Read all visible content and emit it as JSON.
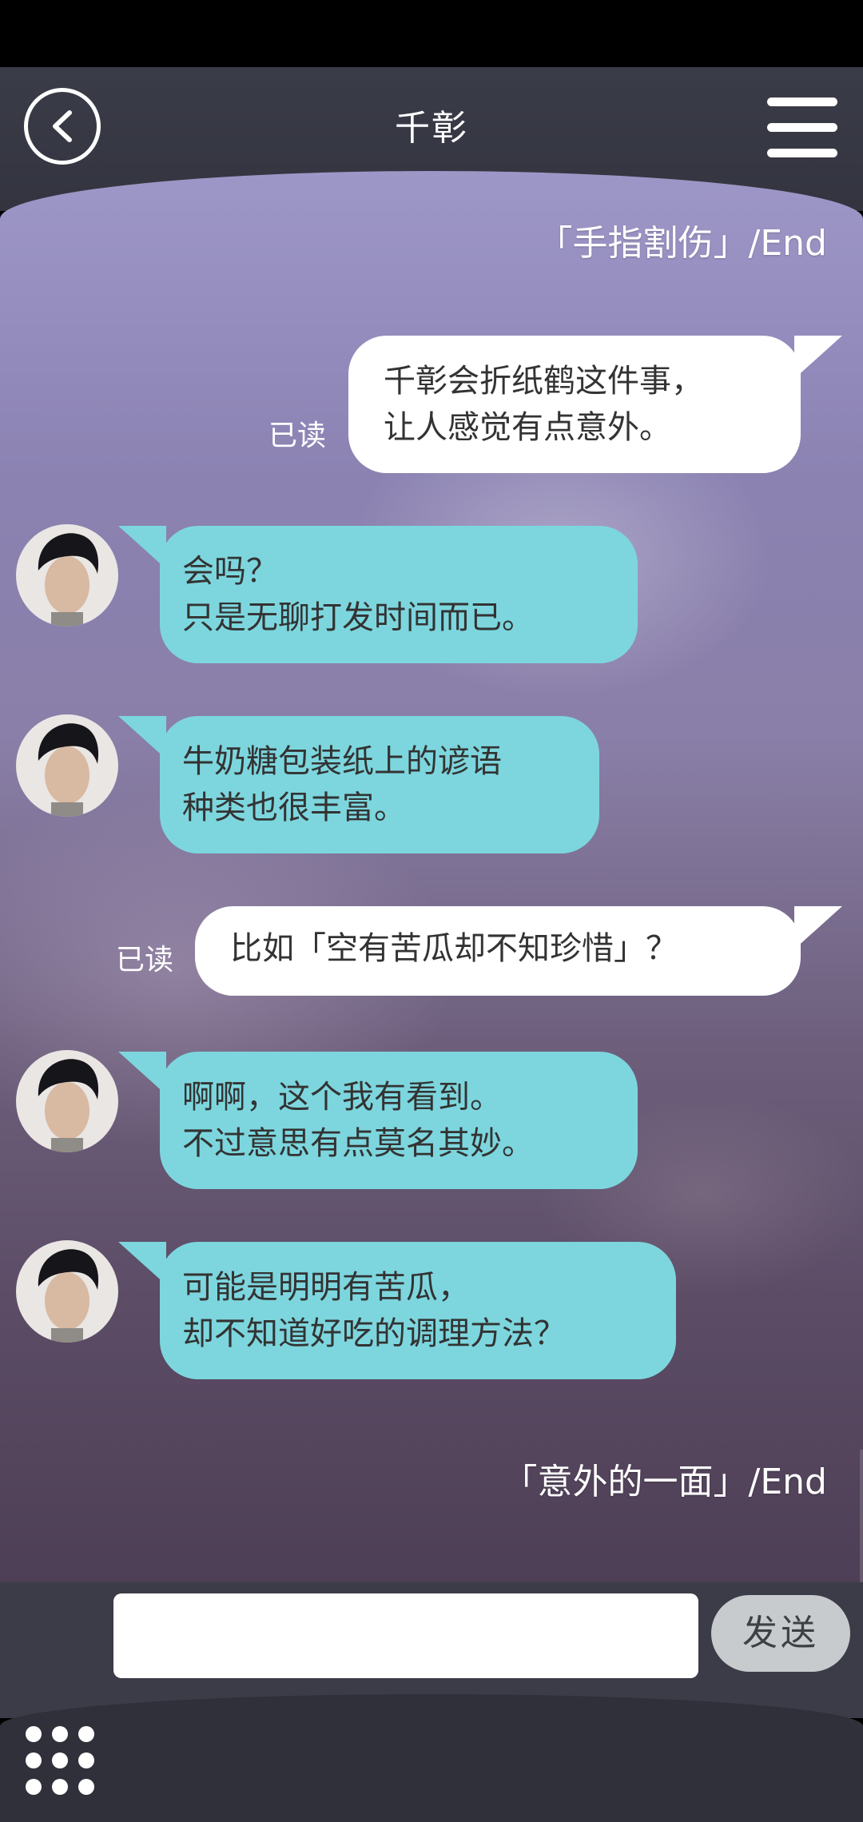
{
  "header": {
    "title": "千彰"
  },
  "chat": {
    "end_label_1": "「手指割伤」/End",
    "end_label_2": "「意外的一面」/End",
    "read_mark": "已读",
    "messages": [
      {
        "side": "out",
        "lines": [
          "千彰会折纸鹤这件事，",
          "让人感觉有点意外。"
        ]
      },
      {
        "side": "in",
        "lines": [
          "会吗？",
          "只是无聊打发时间而已。"
        ]
      },
      {
        "side": "in",
        "lines": [
          "牛奶糖包装纸上的谚语",
          "种类也很丰富。"
        ]
      },
      {
        "side": "out",
        "lines": [
          "比如「空有苦瓜却不知珍惜」？"
        ]
      },
      {
        "side": "in",
        "lines": [
          "啊啊，这个我有看到。",
          "不过意思有点莫名其妙。"
        ]
      },
      {
        "side": "in",
        "lines": [
          "可能是明明有苦瓜，",
          "却不知道好吃的调理方法？"
        ]
      }
    ]
  },
  "composer": {
    "input_value": "",
    "send_label": "发送"
  },
  "icons": {
    "back": "back-arrow-icon",
    "menu": "hamburger-menu-icon",
    "grid": "grid-menu-icon",
    "avatar": "contact-avatar"
  }
}
